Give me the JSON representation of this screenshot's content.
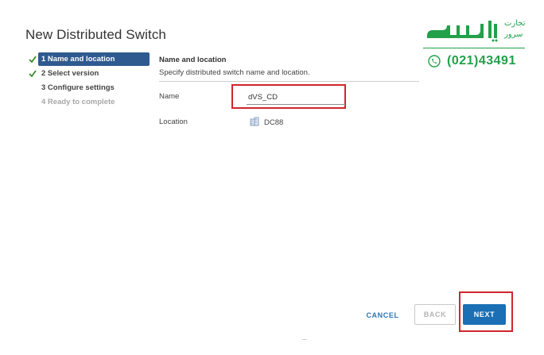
{
  "dialog": {
    "title": "New Distributed Switch"
  },
  "steps": [
    {
      "label": "1 Name and location",
      "state": "active",
      "completed": true
    },
    {
      "label": "2 Select version",
      "state": "normal",
      "completed": true
    },
    {
      "label": "3 Configure settings",
      "state": "normal",
      "completed": false
    },
    {
      "label": "4 Ready to complete",
      "state": "disabled",
      "completed": false
    }
  ],
  "section": {
    "title": "Name and location",
    "description": "Specify distributed switch name and location."
  },
  "form": {
    "name_label": "Name",
    "name_value": "dVS_CD",
    "location_label": "Location",
    "location_value": "DC88"
  },
  "footer": {
    "cancel_label": "CANCEL",
    "back_label": "BACK",
    "next_label": "NEXT"
  },
  "watermark": {
    "brand_text": "پارسه",
    "tagline_top": "تجارت",
    "tagline_bottom": "سرور",
    "phone": "(021)43491",
    "color": "#23a04a"
  },
  "colors": {
    "accent": "#1a6fb5",
    "active_step": "#2f5a8f",
    "highlight": "#d0252d",
    "check": "#3c8a2e"
  }
}
